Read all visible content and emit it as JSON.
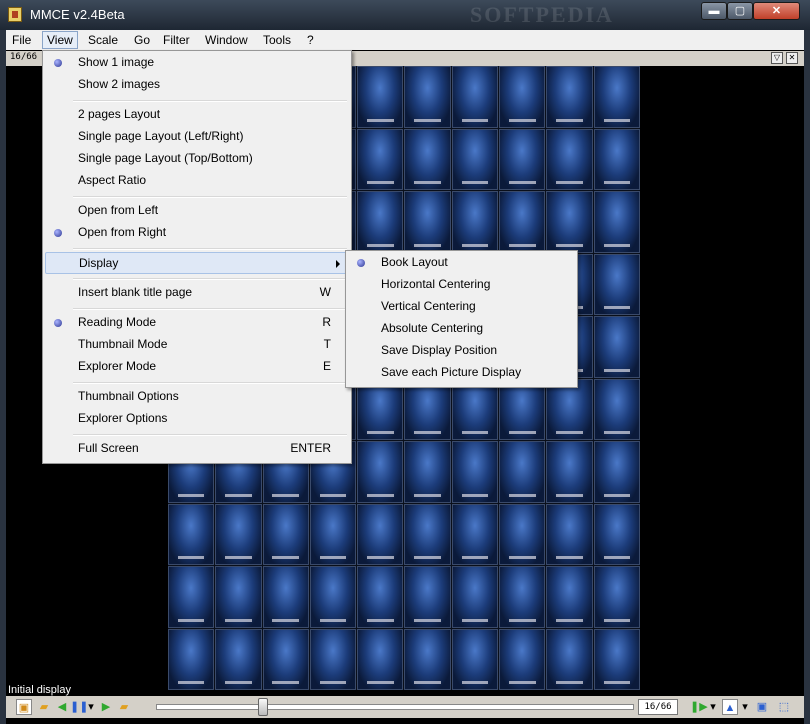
{
  "window": {
    "title": "MMCE v2.4Beta",
    "watermark": "SOFTPEDIA",
    "min_glyph": "▬",
    "max_glyph": "▢",
    "close_glyph": "✕",
    "app_icon": "app-icon"
  },
  "menubar": {
    "items": [
      "File",
      "View",
      "Scale",
      "Go",
      "Filter",
      "Window",
      "Tools",
      "?"
    ],
    "active": "View"
  },
  "pagebar": {
    "page_indicator": "16/66",
    "dropdown_glyph": "▽",
    "close_glyph": "✕"
  },
  "view_menu": {
    "groups": [
      [
        {
          "label": "Show 1 image",
          "checked": true
        },
        {
          "label": "Show 2 images"
        }
      ],
      [
        {
          "label": "2 pages Layout"
        },
        {
          "label": "Single page Layout (Left/Right)"
        },
        {
          "label": "Single page Layout (Top/Bottom)"
        },
        {
          "label": "Aspect Ratio"
        }
      ],
      [
        {
          "label": "Open from Left"
        },
        {
          "label": "Open from Right",
          "checked": true
        }
      ],
      [
        {
          "label": "Display",
          "submenu": true,
          "highlighted": true
        }
      ],
      [
        {
          "label": "Insert blank title page",
          "shortcut": "W"
        }
      ],
      [
        {
          "label": "Reading Mode",
          "shortcut": "R",
          "checked": true
        },
        {
          "label": "Thumbnail Mode",
          "shortcut": "T"
        },
        {
          "label": "Explorer Mode",
          "shortcut": "E"
        }
      ],
      [
        {
          "label": "Thumbnail Options"
        },
        {
          "label": "Explorer Options"
        }
      ],
      [
        {
          "label": "Full Screen",
          "shortcut": "ENTER"
        }
      ]
    ]
  },
  "display_submenu": {
    "items": [
      {
        "label": "Book Layout",
        "checked": true
      },
      {
        "label": "Horizontal Centering"
      },
      {
        "label": "Vertical Centering"
      },
      {
        "label": "Absolute Centering"
      },
      {
        "label": "Save Display Position"
      },
      {
        "label": "Save each Picture Display"
      }
    ]
  },
  "status": {
    "text": "Initial display"
  },
  "toolbar": {
    "page_value": "16/66",
    "left_icons": [
      "folder-icon",
      "previous-arrow-icon",
      "pause-icon",
      "dropdown-arrow-icon",
      "next-arrow-icon",
      "folder-next-icon"
    ],
    "right_icons": [
      "play-icon",
      "dropdown-arrow-icon",
      "fit-icon",
      "dropdown-arrow-icon",
      "image-icon",
      "fullscreen-icon"
    ],
    "colors": {
      "green": "#2fa82f",
      "blue": "#2b5fd0"
    }
  },
  "thumbnails": {
    "count": 100
  }
}
